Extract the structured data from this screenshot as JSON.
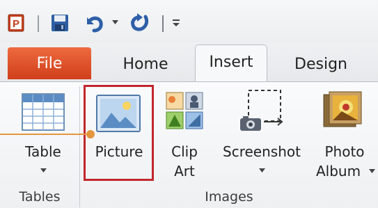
{
  "quick_access": {
    "icons": [
      "powerpoint-app-icon",
      "save-icon",
      "undo-icon",
      "redo-icon",
      "customize-toolbar-icon"
    ]
  },
  "tabs": [
    {
      "label": "File",
      "active": false
    },
    {
      "label": "Home",
      "active": false
    },
    {
      "label": "Insert",
      "active": true
    },
    {
      "label": "Design",
      "active": false
    }
  ],
  "groups": [
    {
      "label": "Tables",
      "buttons": [
        {
          "label": "Table",
          "icon": "table-grid-icon",
          "dropdown": true
        }
      ]
    },
    {
      "label": "Images",
      "buttons": [
        {
          "label": "Picture",
          "icon": "picture-icon",
          "dropdown": false,
          "highlighted": true
        },
        {
          "label_line1": "Clip",
          "label_line2": "Art",
          "icon": "clip-art-icon",
          "dropdown": false
        },
        {
          "label": "Screenshot",
          "icon": "screenshot-icon",
          "dropdown": true
        },
        {
          "label_line1": "Photo",
          "label_line2": "Album",
          "icon": "photo-album-icon",
          "dropdown": true
        }
      ]
    }
  ],
  "colors": {
    "file_tab": "#d9532c",
    "highlight_border": "#c1272d",
    "pointer": "#e3963d"
  }
}
